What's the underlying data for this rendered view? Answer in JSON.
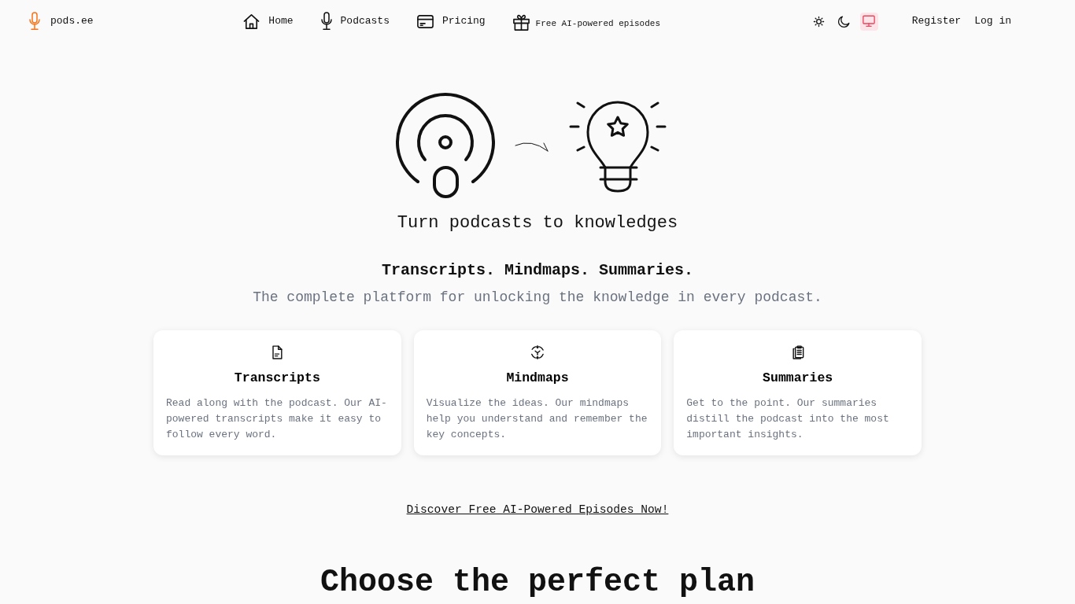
{
  "brand": {
    "name": "pods.ee"
  },
  "nav": [
    {
      "label": "Home",
      "kind": "page"
    },
    {
      "label": "Podcasts",
      "kind": "page"
    },
    {
      "label": "Pricing",
      "kind": "page"
    },
    {
      "label": "Free AI-powered episodes",
      "kind": "promo"
    }
  ],
  "theme_options": [
    {
      "kind": "light",
      "selected": false
    },
    {
      "kind": "dark",
      "selected": false
    },
    {
      "kind": "system",
      "selected": true
    }
  ],
  "auth_links": [
    "Register",
    "Log in"
  ],
  "hero": {
    "tagline": "Turn podcasts to knowledges",
    "headline": "Transcripts. Mindmaps. Summaries.",
    "subtitle": "The complete platform for unlocking the knowledge in every podcast."
  },
  "features": [
    {
      "title": "Transcripts",
      "text": "Read along with the podcast. Our AI-powered transcripts make it easy to follow every word."
    },
    {
      "title": "Mindmaps",
      "text": "Visualize the ideas. Our mindmaps help you understand and remember the key concepts."
    },
    {
      "title": "Summaries",
      "text": "Get to the point. Our summaries distill the podcast into the most important insights."
    }
  ],
  "cta_link": "Discover Free AI-Powered Episodes Now!",
  "pricing": {
    "heading": "Choose the perfect plan"
  }
}
